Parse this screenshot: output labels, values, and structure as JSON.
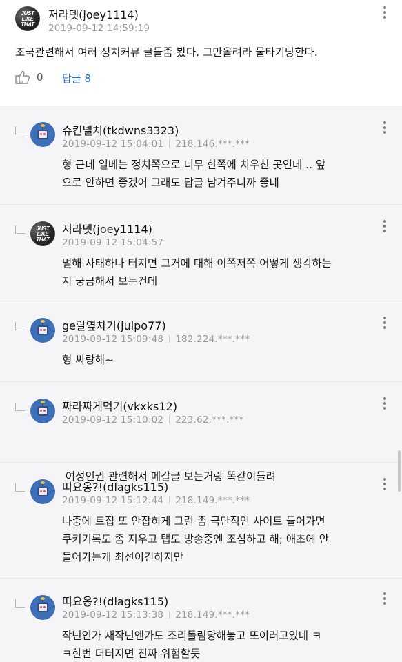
{
  "main_comment": {
    "username": "저라뎃(joey1114)",
    "timestamp": "2019-09-12 14:59:19",
    "text": "조국관련해서 여러 정치커뮤 글들좀 봤다. 그만올려라 물타기당한다.",
    "avatar_text": [
      "JUST",
      "LIKE",
      "THAT"
    ],
    "up_count": "0",
    "reply_label": "답글 8"
  },
  "replies": [
    {
      "username": "슈킨넬치(tkdwns3323)",
      "timestamp": "2019-09-12 15:04:01",
      "ip": "218.146.***.***",
      "lines": [
        "형 근데 일베는 정치쪽으로 너무 한쪽에 치우친 곳인데 .. 앞",
        "으로 안하면 좋겠어 그래도 답글 남겨주니까 좋네"
      ],
      "avatar": "bot"
    },
    {
      "username": "저라뎃(joey1114)",
      "timestamp": "2019-09-12 15:04:57",
      "ip": "",
      "lines": [
        "멀해 사태하나 터지면 그거에 대해 이쪽저쪽 어떻게 생각하는",
        "지 궁금해서 보는건데"
      ],
      "avatar": "just"
    },
    {
      "username": "ge랄옆차기(julpo77)",
      "timestamp": "2019-09-12 15:09:48",
      "ip": "182.224.***.***",
      "lines": [
        "형 싸랑해~"
      ],
      "avatar": "bot"
    },
    {
      "username": "짜라짜게먹기(vkxks12)",
      "timestamp": "2019-09-12 15:10:02",
      "ip": "223.62.***.***",
      "lines": [
        " 여성인권 관련해서 메갈글 보는거랑 똑같이들려"
      ],
      "avatar": "bot"
    },
    {
      "username": "띠요옹?!(dlagks115)",
      "timestamp": "2019-09-12 15:12:44",
      "ip": "218.149.***.***",
      "lines": [
        "나중에 트집 또 안잡히게 그런 좀 극단적인 사이트 들어가면",
        "쿠키기록도 좀 지우고 탭도 방송중엔 조심하고 해; 애초에 안",
        "들어가는게 최선이긴하지만"
      ],
      "avatar": "bot"
    },
    {
      "username": "띠요옹?!(dlagks115)",
      "timestamp": "2019-09-12 15:13:38",
      "ip": "218.149.***.***",
      "lines": [
        "작년인가 재작년엔가도 조리돌림당해놓고 또이러고있네 ㅋ",
        "ㅋ한번 더터지면 진짜 위험할듯"
      ],
      "avatar": "bot"
    }
  ],
  "icons": {
    "up": "thumbs-up-icon",
    "more": "more-vertical-icon",
    "reply_arrow": "reply-indent-icon"
  },
  "colors": {
    "link": "#2a6fc9",
    "meta": "#9a9a9a",
    "reply_bg": "#f5f5f7"
  }
}
